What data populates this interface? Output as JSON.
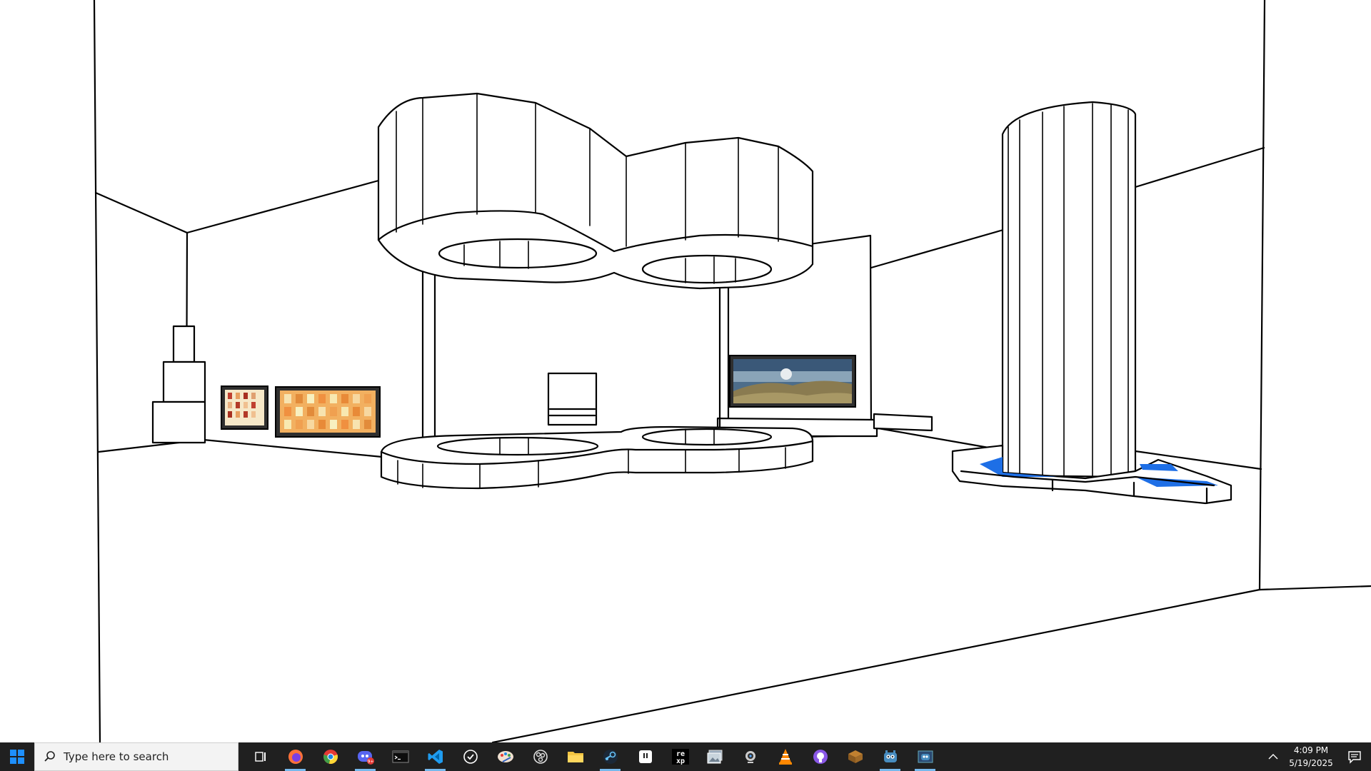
{
  "taskbar": {
    "search_placeholder": "Type here to search",
    "apps": [
      {
        "name": "firefox-icon",
        "active": true
      },
      {
        "name": "chrome-icon",
        "active": false
      },
      {
        "name": "discord-icon",
        "active": true,
        "badge": "9+"
      },
      {
        "name": "terminal-icon",
        "active": false
      },
      {
        "name": "vscode-icon",
        "active": true
      },
      {
        "name": "tasks-icon",
        "active": false
      },
      {
        "name": "paint-icon",
        "active": false
      },
      {
        "name": "obs-icon",
        "active": false
      },
      {
        "name": "file-explorer-icon",
        "active": false
      },
      {
        "name": "steam-icon",
        "active": true
      },
      {
        "name": "tablet-icon",
        "active": false
      },
      {
        "name": "rexpaint-icon",
        "active": false
      },
      {
        "name": "image-viewer-icon",
        "active": false
      },
      {
        "name": "webcam-icon",
        "active": false
      },
      {
        "name": "vlc-icon",
        "active": false
      },
      {
        "name": "github-icon",
        "active": false
      },
      {
        "name": "package-icon",
        "active": false
      },
      {
        "name": "godot-icon",
        "active": true
      },
      {
        "name": "godot-editor-icon",
        "active": true
      }
    ],
    "clock": {
      "time": "4:09 PM",
      "date": "5/19/2025"
    }
  }
}
